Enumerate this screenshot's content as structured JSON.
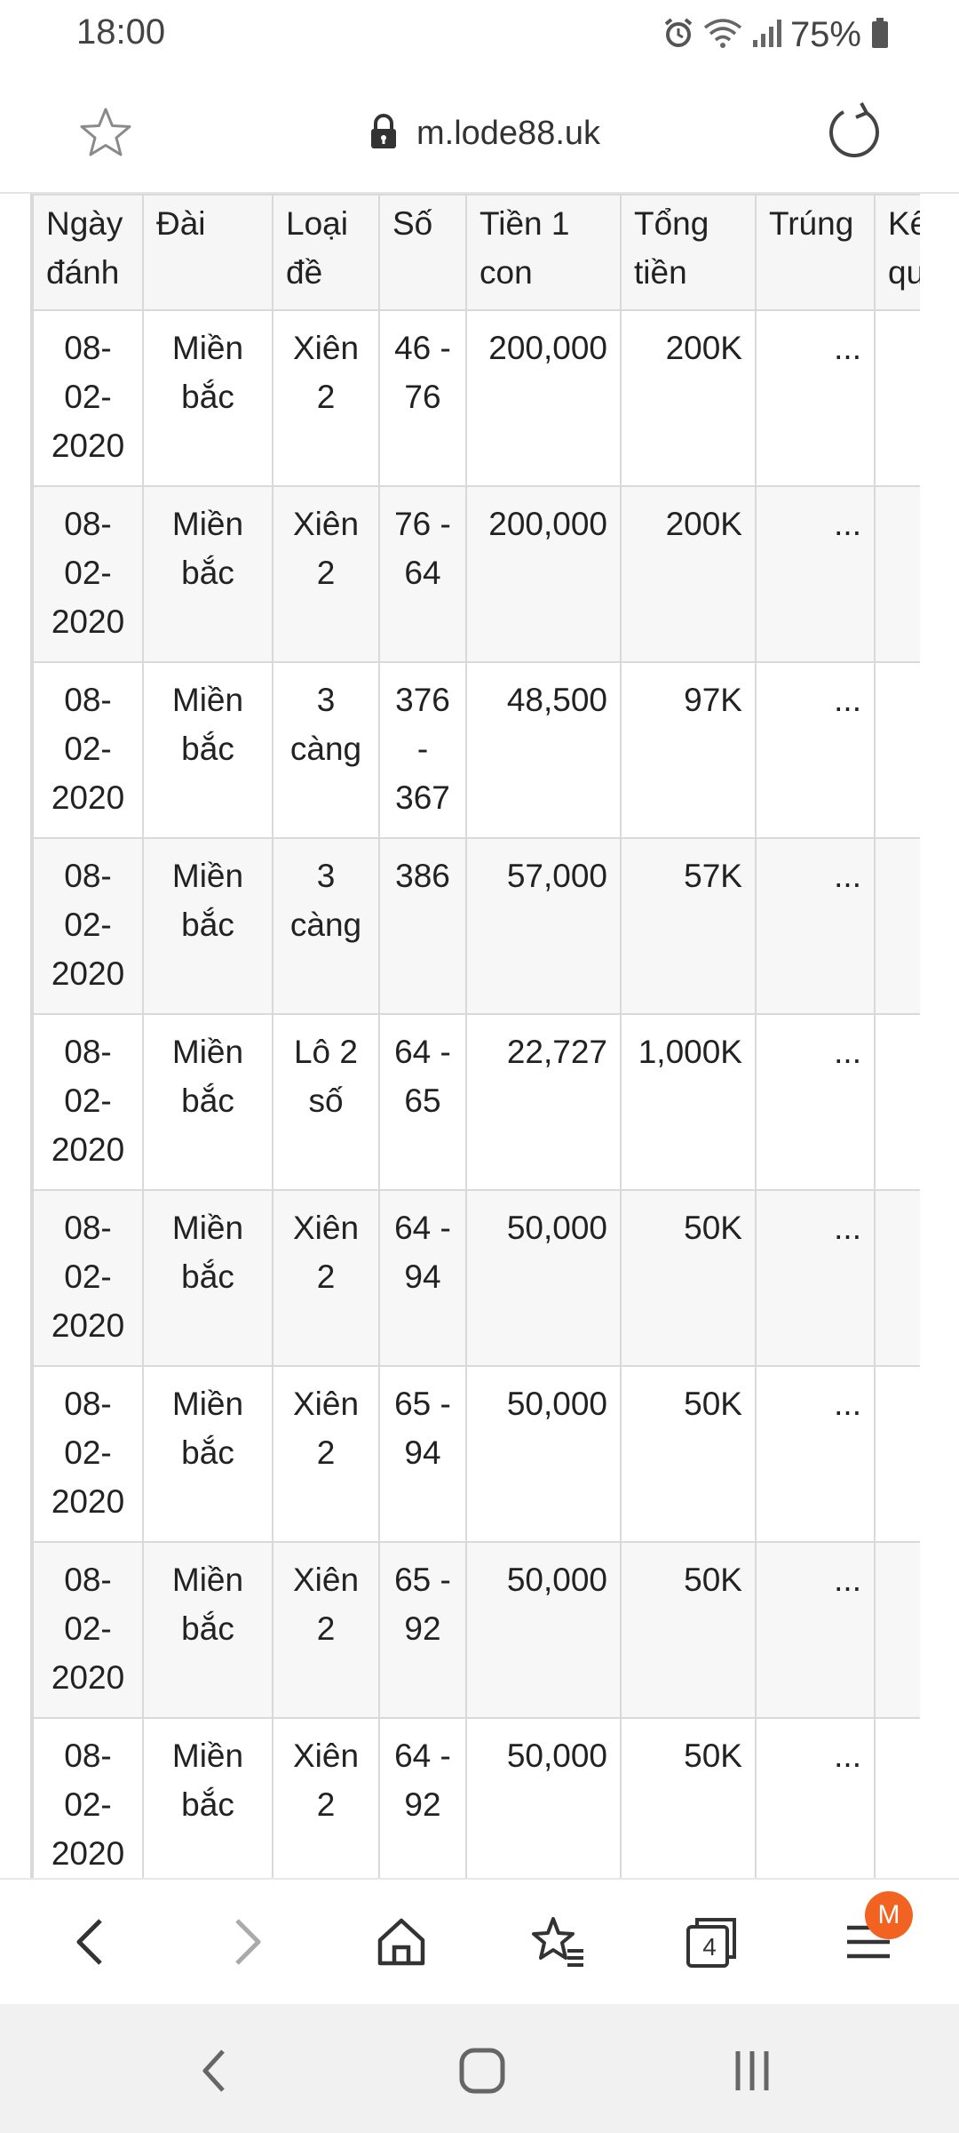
{
  "status_bar": {
    "time": "18:00",
    "battery": "75%",
    "icons": [
      "alarm-icon",
      "wifi-icon",
      "signal-icon",
      "battery-icon"
    ]
  },
  "browser": {
    "url": "m.lode88.uk",
    "icons": [
      "star-icon",
      "lock-icon",
      "reload-icon"
    ]
  },
  "table": {
    "headers": [
      "Ngày đánh",
      "Đài",
      "Loại đề",
      "Số",
      "Tiền 1 con",
      "Tổng tiền",
      "Trúng",
      "Kết quả"
    ],
    "rows": [
      {
        "date": "08-02-2020",
        "station": "Miền bắc",
        "type": "Xiên 2",
        "number": "46 - 76",
        "per_unit": "200,000",
        "total": "200K",
        "win": "..."
      },
      {
        "date": "08-02-2020",
        "station": "Miền bắc",
        "type": "Xiên 2",
        "number": "76 - 64",
        "per_unit": "200,000",
        "total": "200K",
        "win": "..."
      },
      {
        "date": "08-02-2020",
        "station": "Miền bắc",
        "type": "3 càng",
        "number": "376 - 367",
        "per_unit": "48,500",
        "total": "97K",
        "win": "..."
      },
      {
        "date": "08-02-2020",
        "station": "Miền bắc",
        "type": "3 càng",
        "number": "386",
        "per_unit": "57,000",
        "total": "57K",
        "win": "..."
      },
      {
        "date": "08-02-2020",
        "station": "Miền bắc",
        "type": "Lô 2 số",
        "number": "64 - 65",
        "per_unit": "22,727",
        "total": "1,000K",
        "win": "..."
      },
      {
        "date": "08-02-2020",
        "station": "Miền bắc",
        "type": "Xiên 2",
        "number": "64 - 94",
        "per_unit": "50,000",
        "total": "50K",
        "win": "..."
      },
      {
        "date": "08-02-2020",
        "station": "Miền bắc",
        "type": "Xiên 2",
        "number": "65 - 94",
        "per_unit": "50,000",
        "total": "50K",
        "win": "..."
      },
      {
        "date": "08-02-2020",
        "station": "Miền bắc",
        "type": "Xiên 2",
        "number": "65 - 92",
        "per_unit": "50,000",
        "total": "50K",
        "win": "..."
      },
      {
        "date": "08-02-2020",
        "station": "Miền bắc",
        "type": "Xiên 2",
        "number": "64 - 92",
        "per_unit": "50,000",
        "total": "50K",
        "win": "..."
      }
    ]
  },
  "bottom_toolbar": {
    "tabs_count": "4",
    "profile_badge": "M",
    "accent_color": "#f26322",
    "icons": [
      "back-icon",
      "forward-icon",
      "home-icon",
      "bookmarks-icon",
      "tabs-icon",
      "menu-icon"
    ]
  },
  "nav_bar": {
    "icons": [
      "nav-back-icon",
      "nav-home-icon",
      "nav-recents-icon"
    ]
  }
}
